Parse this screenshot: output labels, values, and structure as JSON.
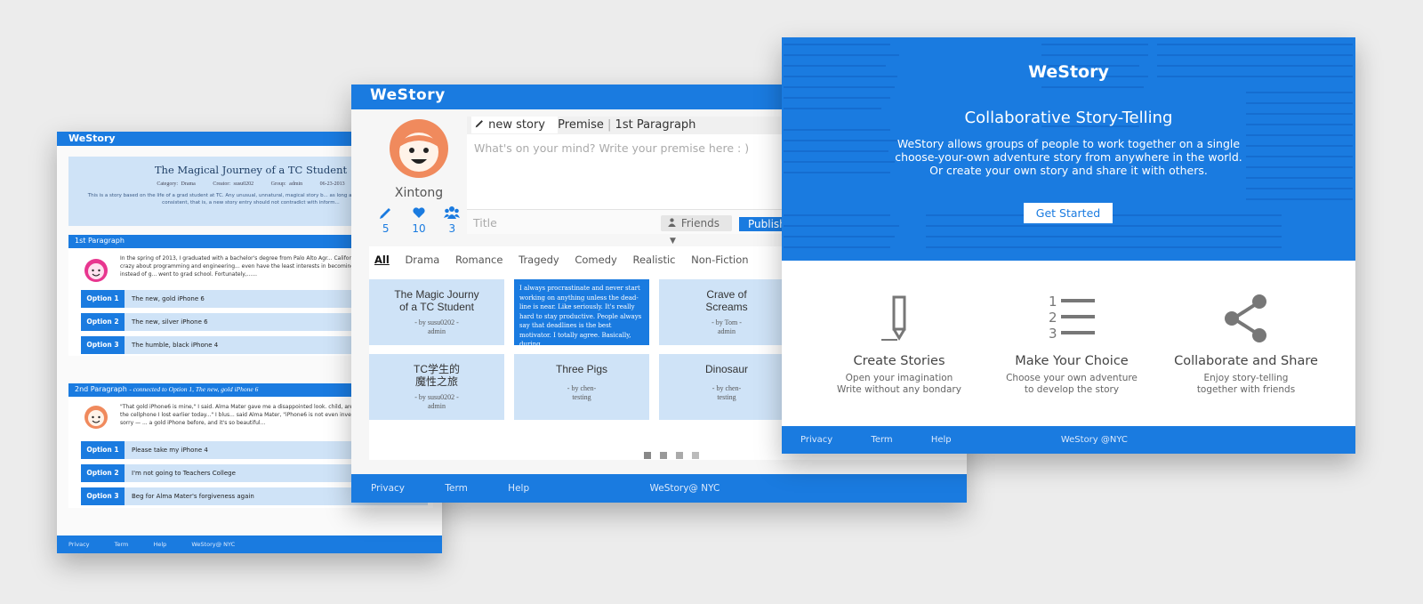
{
  "screen_left": {
    "brand": "WeStory",
    "story": {
      "title": "The Magical Journey of a TC Student",
      "category": "Category: Drama",
      "creator": "Creator: susu0202",
      "group": "Group: admin",
      "date": "06-23-2013",
      "description": "This is a story based on the life of a grad student at TC. Any unusual, unnatural, magical story b... as long as the storyline is logically consistent, that is, a new story entry should not contradict with inform..."
    },
    "paragraph1": {
      "heading": "1st Paragraph",
      "text": "In the spring of 2013, I graduated with a bachelor's degree from Palo Alto Agr... California, where most people are crazy about programming and engineering... even have the least interests in becoming a software engineer. So instead of g... went to grad school. Fortunately,......",
      "options": [
        {
          "label": "Option 1",
          "text": "The new, gold iPhone 6"
        },
        {
          "label": "Option 2",
          "text": "The new, silver iPhone 6"
        },
        {
          "label": "Option 3",
          "text": "The humble, black iPhone 4"
        }
      ]
    },
    "paragraph2": {
      "heading": "2nd Paragraph",
      "connected": "- connected to Option 1, The new, gold iPhone 6",
      "text": "\"That gold iPhone6 is mine,\" I said. Alma Mater gave me a disappointed look. child, are you?\" \"What? ... but that is the cellphone I lost earlier today...\" I blus... said Alma Mater, \"iPhone6 is not even invented in 2013.\" \"...ah, I'm so sorry — ... a gold iPhone before, and it's so beautiful...",
      "options": [
        {
          "label": "Option 1",
          "text": "Please take my iPhone 4"
        },
        {
          "label": "Option 2",
          "text": "I'm not going to Teachers College"
        },
        {
          "label": "Option 3",
          "text": "Beg for Alma Mater's forgiveness again"
        }
      ]
    },
    "footer": {
      "privacy": "Privacy",
      "term": "Term",
      "help": "Help",
      "copyright": "WeStory@ NYC"
    }
  },
  "screen_middle": {
    "brand": "WeStory",
    "user": {
      "name": "Xintong",
      "stories": "5",
      "likes": "10",
      "groups": "3"
    },
    "editor": {
      "tab_new": "new story",
      "tab_premise": "Premise",
      "tab_para": "1st Paragraph",
      "placeholder": "What's on your mind? Write your premise here : )",
      "title_placeholder": "Title",
      "audience": "Friends",
      "publish": "Publish"
    },
    "categories": [
      "All",
      "Drama",
      "Romance",
      "Tragedy",
      "Comedy",
      "Realistic",
      "Non-Fiction"
    ],
    "tiles": [
      {
        "title": "The Magic Journy of a TC Student",
        "by": "- by susu0202 -",
        "group": "admin"
      },
      {
        "excerpt": "I always procrastinate and never start working on anything unless the dead-line is near. Like seriously. It's really hard to stay productive. People always say that deadlines is the best motivator. I totally agree. Basically, during ......"
      },
      {
        "title": "Crave of Screams",
        "by": "- by Tom -",
        "group": "admin"
      },
      {
        "title": "TC学生的 魔性之旅",
        "by": "- by susu0202 -",
        "group": "admin"
      },
      {
        "title": "Three Pigs",
        "by": "- by chen-",
        "group": "testing"
      },
      {
        "title": "Dinosaur",
        "by": "- by chen-",
        "group": "testing"
      }
    ],
    "footer": {
      "privacy": "Privacy",
      "term": "Term",
      "help": "Help",
      "copyright": "WeStory@ NYC"
    }
  },
  "screen_right": {
    "brand": "WeStory",
    "tagline": "Collaborative Story-Telling",
    "lead": [
      "WeStory allows groups of people to work  together on a single",
      "choose-your-own adventure story from anywhere in the world.",
      "Or create your own story and share it with others."
    ],
    "cta": "Get Started",
    "features": [
      {
        "icon": "pencil-icon",
        "title": "Create Stories",
        "lines": [
          "Open your imagination",
          "Write without any bondary"
        ]
      },
      {
        "icon": "numbered-list-icon",
        "title": "Make Your Choice",
        "lines": [
          "Choose your own adventure",
          "to develop the story"
        ]
      },
      {
        "icon": "share-icon",
        "title": "Collaborate and Share",
        "lines": [
          "Enjoy story-telling",
          "together with friends"
        ]
      }
    ],
    "footer": {
      "privacy": "Privacy",
      "term": "Term",
      "help": "Help",
      "copyright": "WeStory @NYC"
    }
  },
  "colors": {
    "accent": "#1a7be0",
    "light_blue": "#cfe3f7",
    "avatar_orange": "#f08a5d",
    "avatar_pink": "#e8368f",
    "icon_gray": "#777777"
  }
}
